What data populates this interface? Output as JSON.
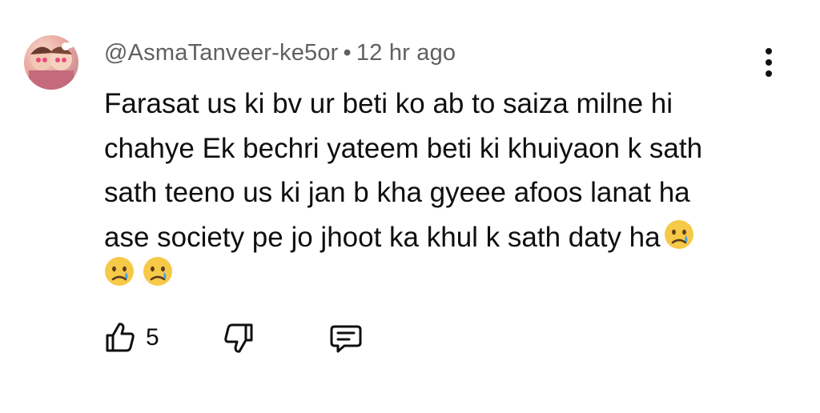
{
  "comment": {
    "author": "@AsmaTanveer-ke5or",
    "separator": "•",
    "time": "12 hr ago",
    "text": "Farasat us ki bv ur beti ko ab to saiza milne hi\nchahye Ek bechri yateem beti ki khuiyaon k sath\nsath teeno us ki jan b kha gyeee afoos lanat ha\nase society pe jo jhoot ka khul k sath daty ha",
    "trailing_emojis": [
      "crying-face",
      "crying-face",
      "crying-face"
    ],
    "like_count": "5"
  },
  "icons": {
    "avatar": "user-avatar-image",
    "more": "more-vertical-icon",
    "like": "thumbs-up-icon",
    "dislike": "thumbs-down-icon",
    "reply": "reply-comment-icon",
    "emoji": "crying-face-emoji"
  },
  "colors": {
    "text": "#0f0f0f",
    "meta": "#606060",
    "emoji_face": "#f7c948",
    "tear": "#3aa0e6"
  }
}
